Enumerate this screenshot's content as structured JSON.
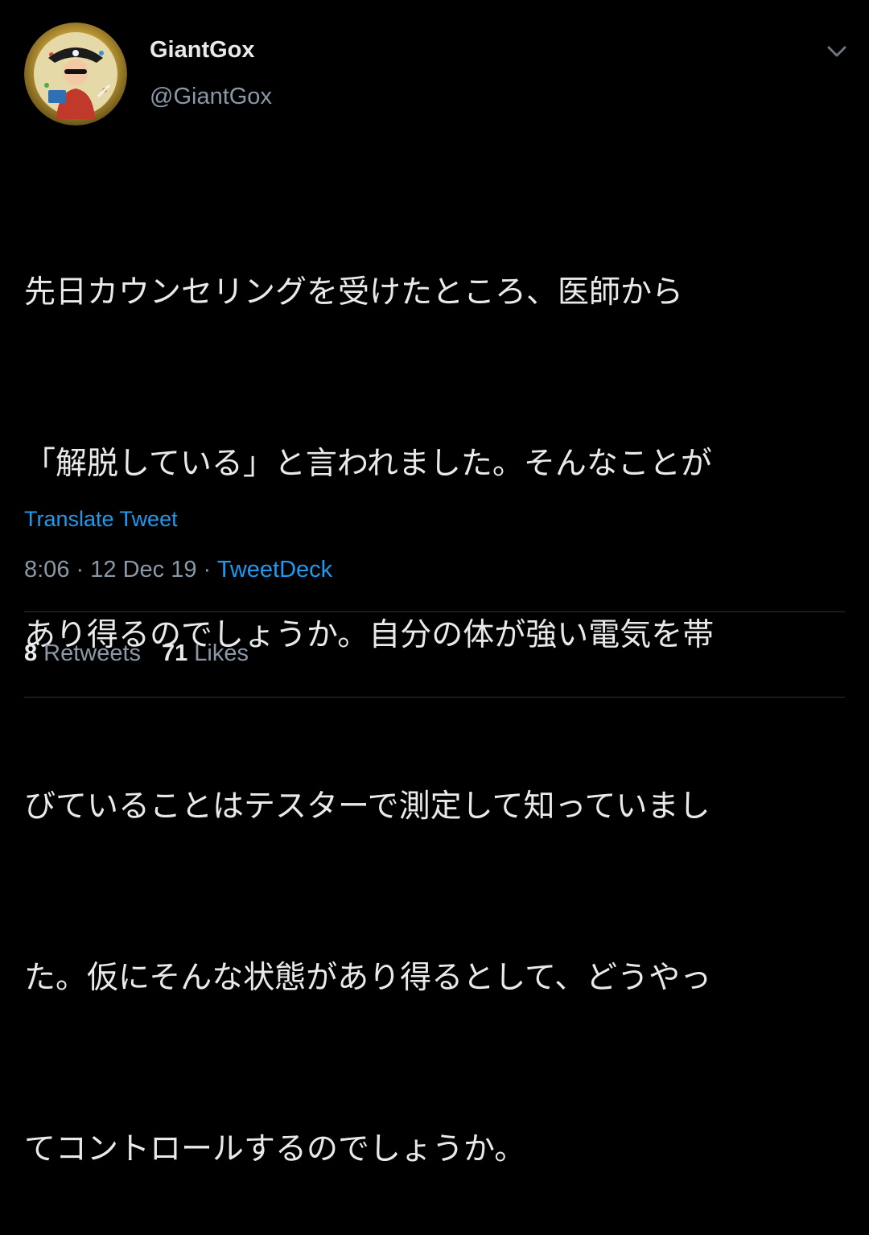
{
  "tweet": {
    "author": {
      "display_name": "GiantGox",
      "handle": "@GiantGox",
      "avatar_icon": "pirate-avatar-icon"
    },
    "menu_icon": "chevron-down-icon",
    "text_lines": [
      "先日カウンセリングを受けたところ、医師から",
      "「解脱している」と言われました。そんなことが",
      "あり得るのでしょうか。自分の体が強い電気を帯",
      "びていることはテスターで測定して知っていまし",
      "た。仮にそんな状態があり得るとして、どうやっ",
      "てコントロールするのでしょうか。"
    ],
    "translate_label": "Translate Tweet",
    "time": "8:06",
    "date": "12 Dec 19",
    "separator": "·",
    "source": "TweetDeck",
    "retweets": {
      "count": "8",
      "label": "Retweets"
    },
    "likes": {
      "count": "71",
      "label": "Likes"
    }
  },
  "colors": {
    "background": "#000000",
    "primary_text": "#e7e9ea",
    "secondary_text": "#8b98a5",
    "link": "#1d9bf0",
    "divider": "#2f3336"
  }
}
